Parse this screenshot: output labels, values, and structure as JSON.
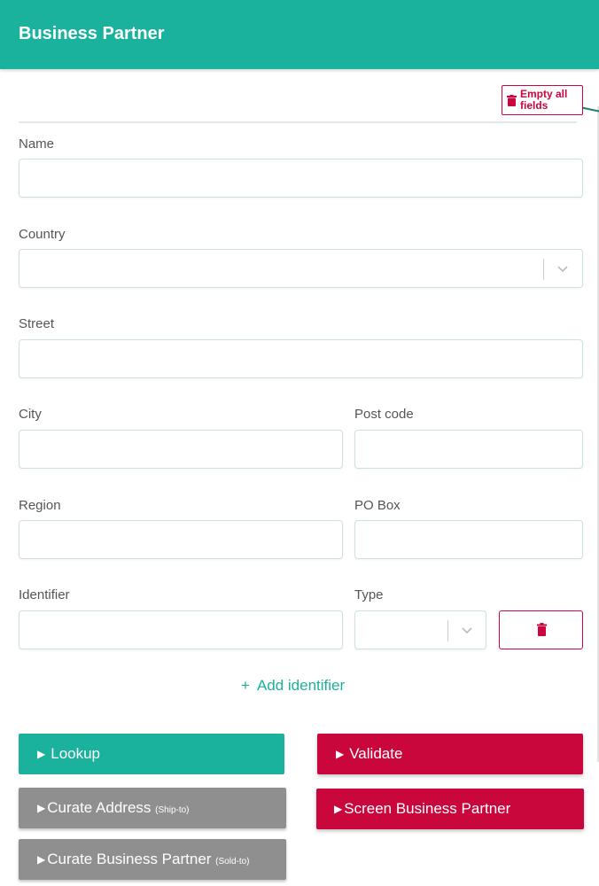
{
  "header": {
    "title": "Business Partner"
  },
  "toolbar": {
    "empty_all_label": "Empty all fields"
  },
  "form": {
    "name": {
      "label": "Name",
      "value": ""
    },
    "country": {
      "label": "Country",
      "value": ""
    },
    "street": {
      "label": "Street",
      "value": ""
    },
    "city": {
      "label": "City",
      "value": ""
    },
    "post_code": {
      "label": "Post code",
      "value": ""
    },
    "region": {
      "label": "Region",
      "value": ""
    },
    "po_box": {
      "label": "PO Box",
      "value": ""
    },
    "identifier": {
      "label": "Identifier",
      "value": ""
    },
    "type": {
      "label": "Type",
      "value": ""
    },
    "add_identifier_label": "Add identifier"
  },
  "actions": {
    "lookup": "Lookup",
    "validate": "Validate",
    "curate_address": "Curate Address",
    "curate_address_sub": "(Ship-to)",
    "screen_bp": "Screen Business Partner",
    "curate_bp": "Curate Business Partner",
    "curate_bp_sub": "(Sold-to)"
  },
  "colors": {
    "accent": "#1ab29c",
    "danger": "#c9073c",
    "neutral": "#8f8f8f"
  },
  "icons": {
    "trash": "trash-icon",
    "chevron": "chevron-down-icon",
    "plus": "plus-icon",
    "play": "play-icon"
  }
}
